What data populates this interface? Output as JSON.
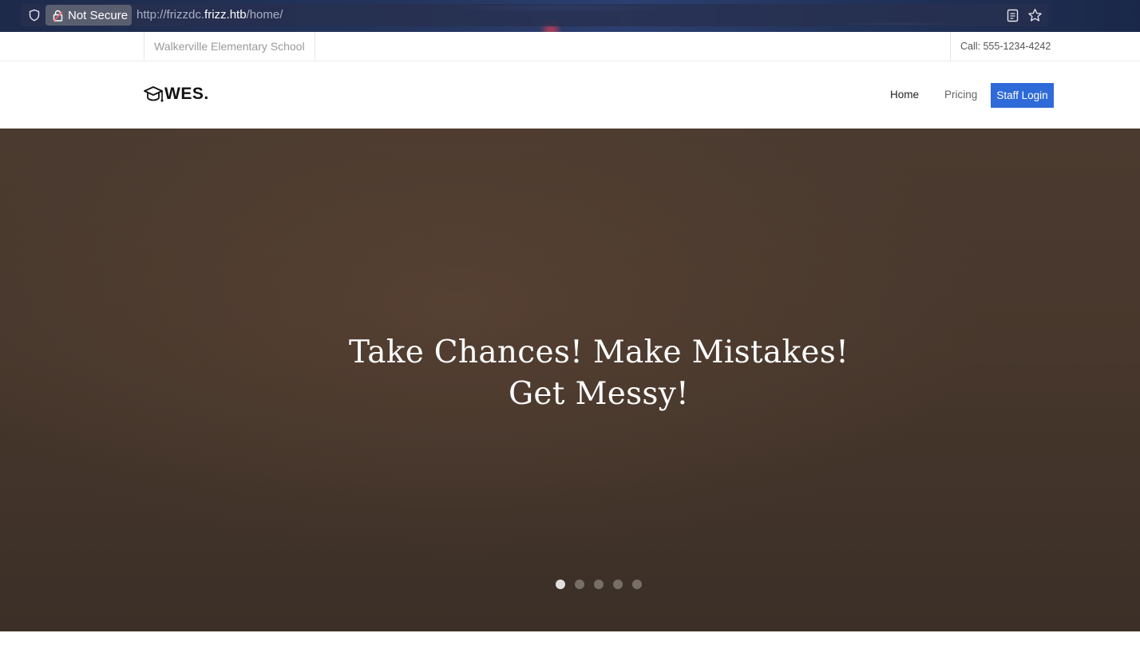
{
  "browser": {
    "security_label": "Not Secure",
    "url_prefix": "http://frizzdc.",
    "url_host": "frizz.htb",
    "url_path": "/home/"
  },
  "topbar": {
    "school_name": "Walkerville Elementary School",
    "phone": "Call: 555-1234-4242"
  },
  "navbar": {
    "brand": "WES.",
    "links": [
      {
        "label": "Home",
        "active": true
      },
      {
        "label": "Pricing",
        "active": false
      }
    ],
    "login_button": "Staff Login"
  },
  "hero": {
    "title": "Take Chances! Make Mistakes! Get Messy!",
    "slides_total": 5,
    "active_slide": 1
  },
  "colors": {
    "accent": "#2e6ad8",
    "hero_bg": "#47372c"
  }
}
